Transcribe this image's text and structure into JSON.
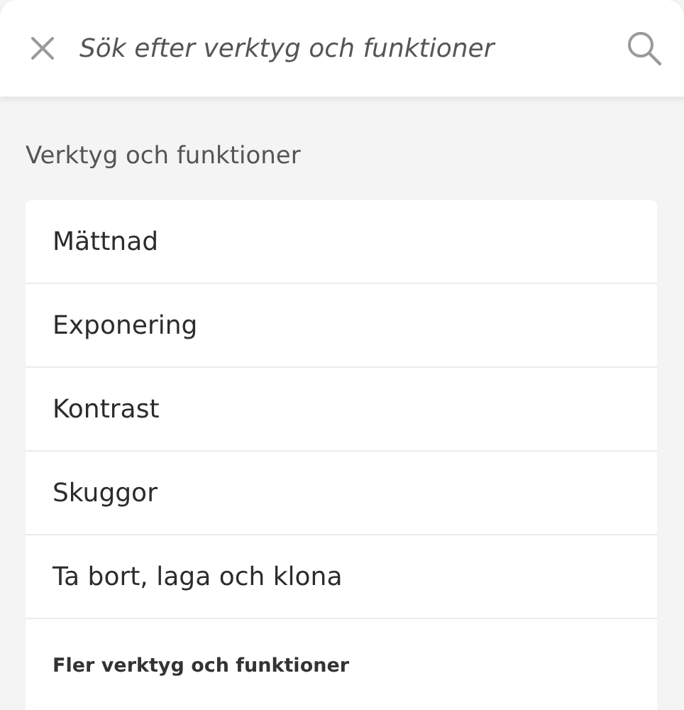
{
  "search": {
    "placeholder": "Sök efter verktyg och funktioner"
  },
  "section_title": "Verktyg och funktioner",
  "tools": [
    {
      "label": "Mättnad"
    },
    {
      "label": "Exponering"
    },
    {
      "label": "Kontrast"
    },
    {
      "label": "Skuggor"
    },
    {
      "label": "Ta bort, laga och klona"
    }
  ],
  "more_heading": "Fler verktyg och funktioner"
}
